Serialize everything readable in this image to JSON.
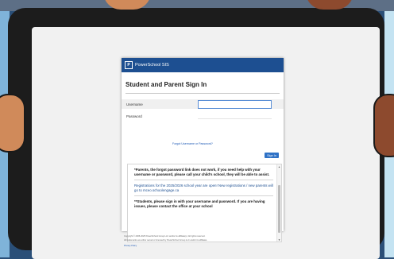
{
  "brand": {
    "name": "PowerSchool SIS",
    "logo_letter": "P"
  },
  "heading": "Student and Parent Sign In",
  "form": {
    "username_label": "Username",
    "password_label": "Password",
    "username_value": "",
    "password_value": "",
    "forgot_link": "Forgot Username or Password?",
    "signin_button": "Sign In"
  },
  "notices": {
    "parents": "*Parents, the forgot password link does not work, if you need help with your username or password, please call your child's school, they will be able to assist.",
    "registration": "Registrations for the 2025/2026 school year are open! New registrations / new parents will go to mceo.schoolengage.ca",
    "students": "**Students, please sign in with your username and password. If you are having issues, please contact the office at your school"
  },
  "footer": {
    "copyright": "Copyright © 2005-2025 PowerSchool Group LLC and/or its affiliate(s). All rights reserved.",
    "trademarks": "All trademarks are either owned or licensed by PowerSchool Group LLC and/or its affiliates.",
    "privacy": "Privacy Policy"
  },
  "colors": {
    "brand": "#1d4f91",
    "button": "#2f72c6",
    "link": "#1d59b5"
  }
}
